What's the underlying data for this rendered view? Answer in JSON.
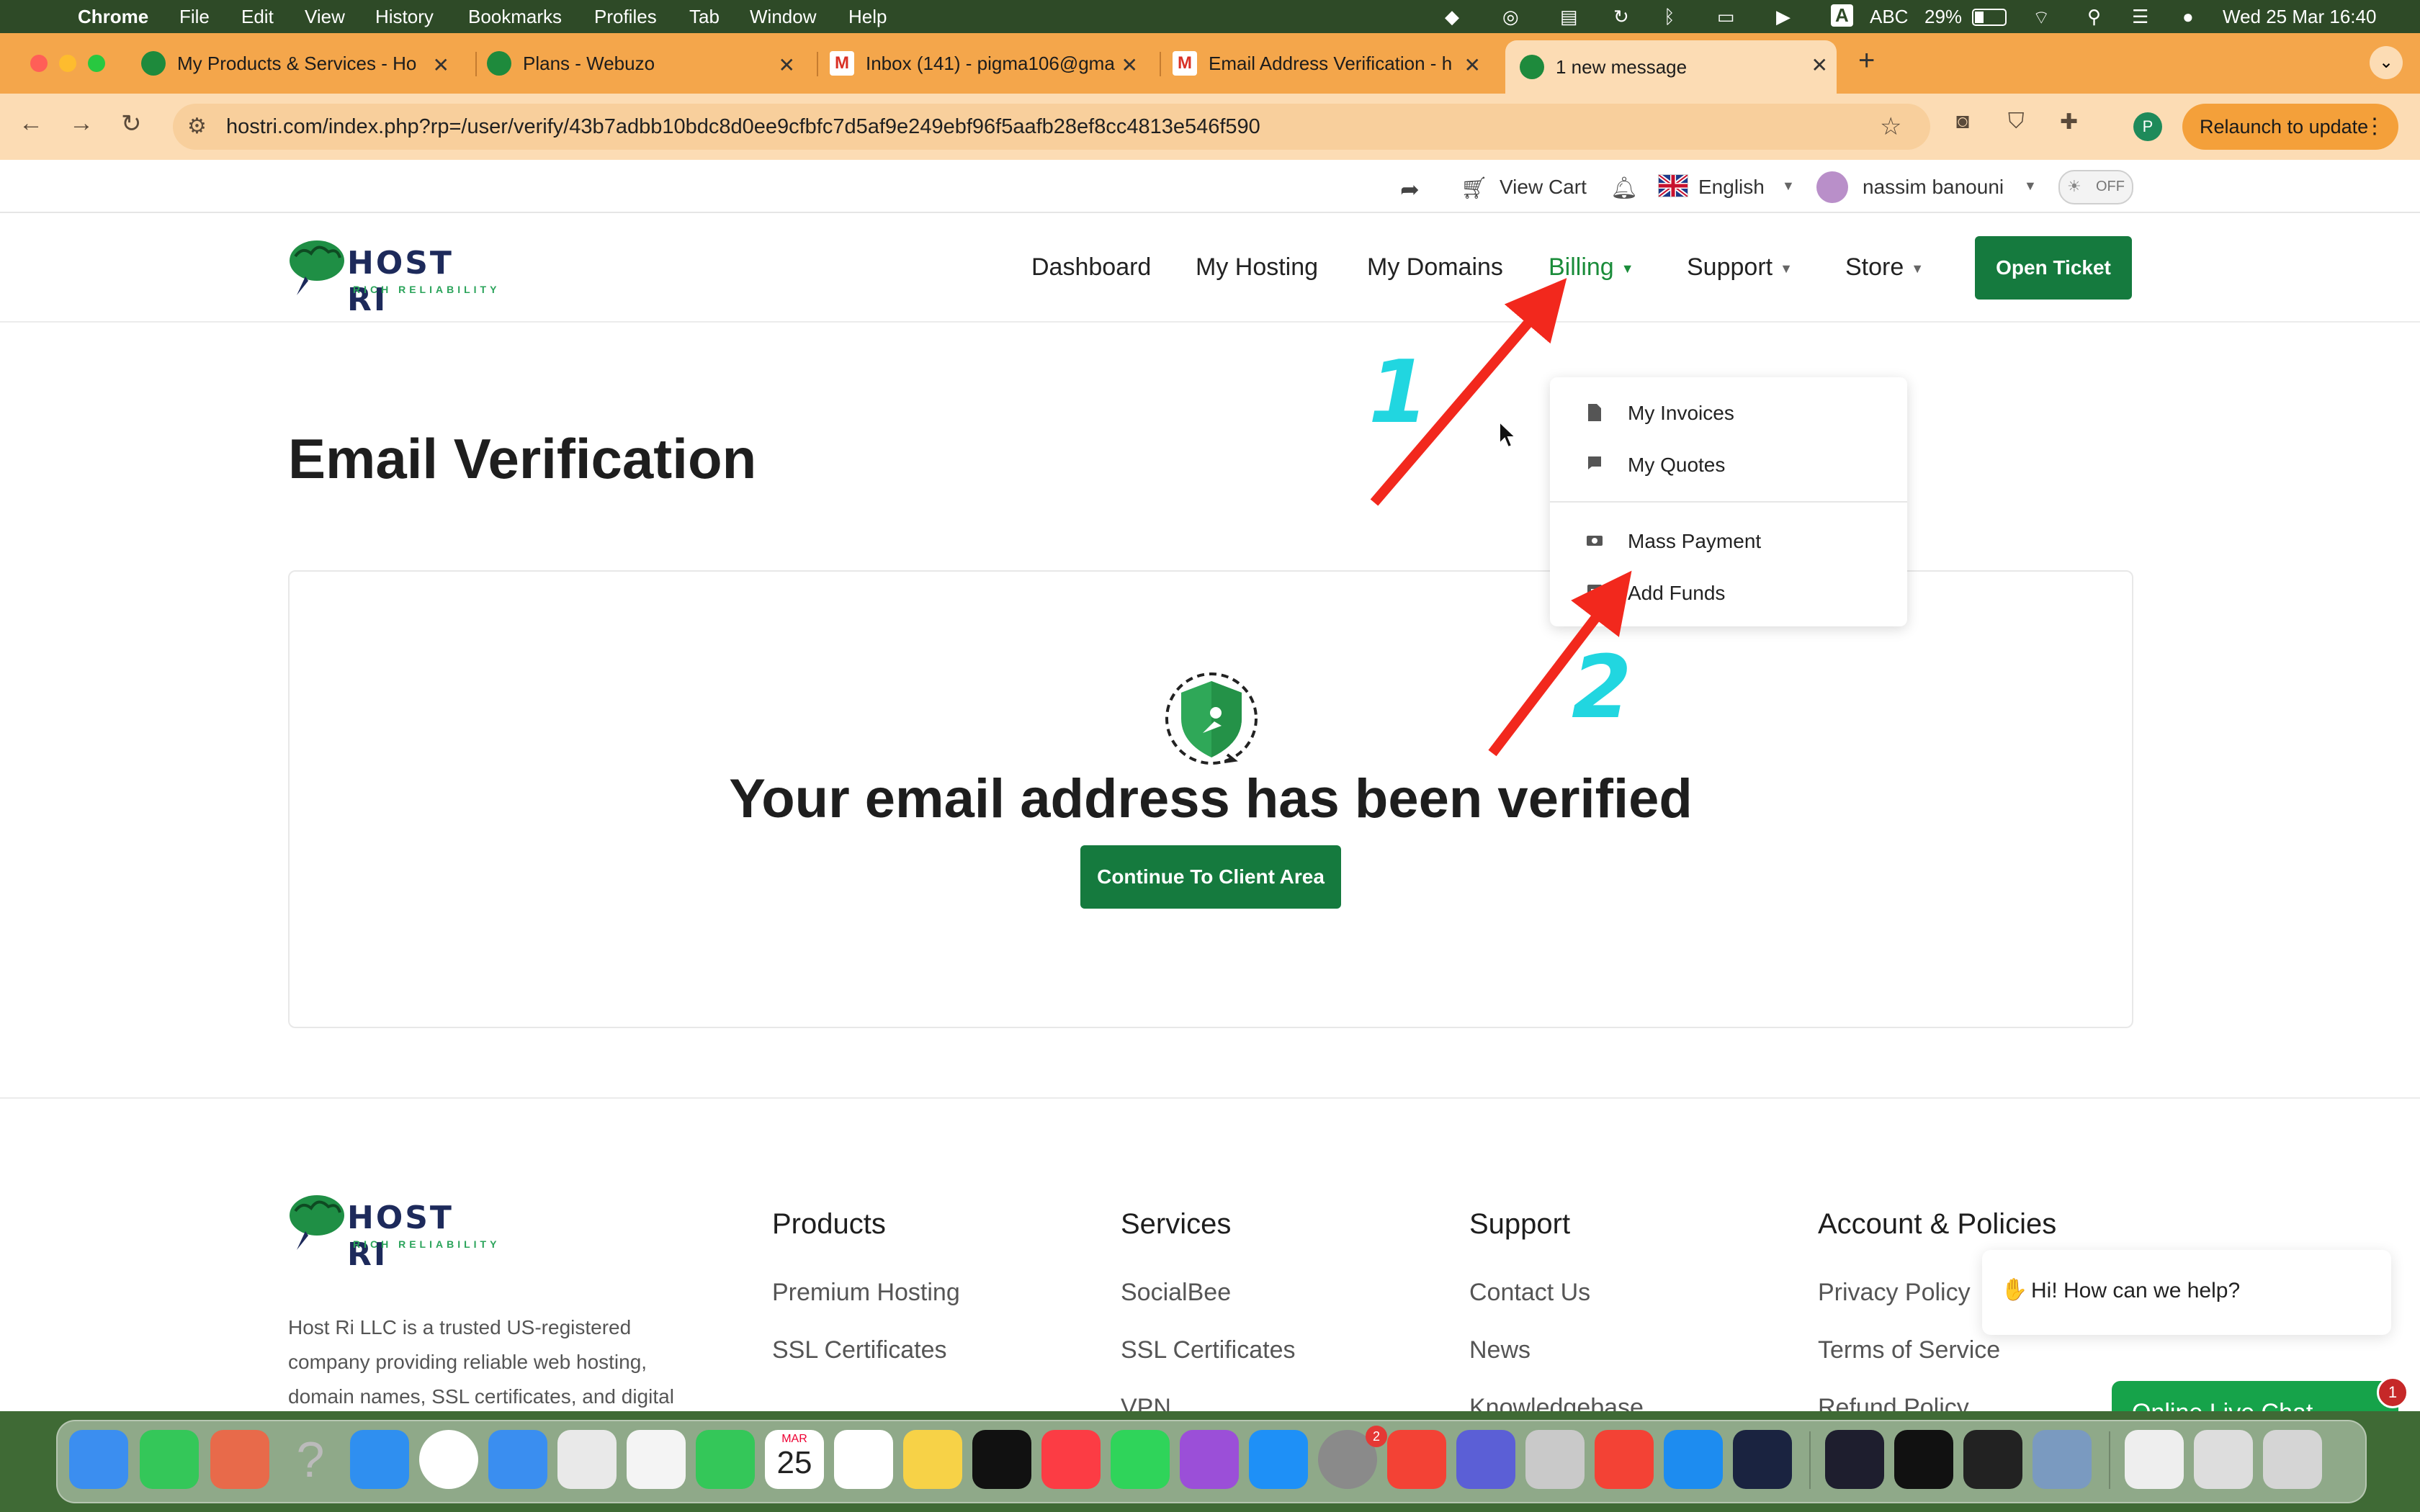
{
  "menubar": {
    "app": "Chrome",
    "items": [
      "File",
      "Edit",
      "View",
      "History",
      "Bookmarks",
      "Profiles",
      "Tab",
      "Window",
      "Help"
    ],
    "status": {
      "input_source": "ABC",
      "input_letter": "A",
      "battery": "29%",
      "datetime": "Wed 25 Mar  16:40"
    }
  },
  "browser": {
    "tabs": [
      {
        "label": "My Products & Services - Ho"
      },
      {
        "label": "Plans - Webuzo"
      },
      {
        "label": "Inbox (141) - pigma106@gma"
      },
      {
        "label": "Email Address Verification - h"
      },
      {
        "label": "1 new message"
      }
    ],
    "new_tab": "+",
    "url": "hostri.com/index.php?rp=/user/verify/43b7adbb10bdc8d0ee9cfbfc7d5af9e249ebf96f5aafb28ef8cc4813e546f590",
    "profile_letter": "P",
    "relaunch_label": "Relaunch to update"
  },
  "topbar": {
    "view_cart": "View Cart",
    "language": "English",
    "user": "nassim banouni",
    "dark_toggle": "OFF"
  },
  "logo": {
    "name": "HOST RI",
    "tagline": "RICH RELIABILITY"
  },
  "nav": {
    "items": [
      "Dashboard",
      "My Hosting",
      "My Domains",
      "Billing",
      "Support",
      "Store"
    ],
    "open_ticket": "Open Ticket"
  },
  "billing_menu": [
    "My Invoices",
    "My Quotes",
    "Mass Payment",
    "Add Funds"
  ],
  "main": {
    "title": "Email Verification",
    "message": "Your email address has been verified",
    "continue_button": "Continue To Client Area"
  },
  "annotations": {
    "one": "1",
    "two": "2",
    "arrow_color": "#f2281d",
    "number_color": "#21d6e0"
  },
  "footer": {
    "description": "Host Ri LLC is a trusted US-registered company providing reliable web hosting, domain names, SSL certificates, and digital solutions tailored for individuals and",
    "columns": [
      {
        "heading": "Products",
        "links": [
          "Premium Hosting",
          "SSL Certificates"
        ]
      },
      {
        "heading": "Services",
        "links": [
          "SocialBee",
          "SSL Certificates",
          "VPN"
        ]
      },
      {
        "heading": "Support",
        "links": [
          "Contact Us",
          "News",
          "Knowledgebase"
        ]
      },
      {
        "heading": "Account & Policies",
        "links": [
          "Privacy Policy",
          "Terms of Service",
          "Refund Policy"
        ]
      }
    ]
  },
  "chat": {
    "greeting": "Hi! How can we help?",
    "button": "Online Live Chat",
    "badge": "1"
  },
  "dock": {
    "calendar_month": "MAR",
    "calendar_day": "25",
    "settings_badge": "2"
  },
  "colors": {
    "brand_green": "#157a3e",
    "tab_strip": "#f4a64b",
    "toolbar": "#fcdcb4",
    "billing_active": "#1a8c3a"
  }
}
